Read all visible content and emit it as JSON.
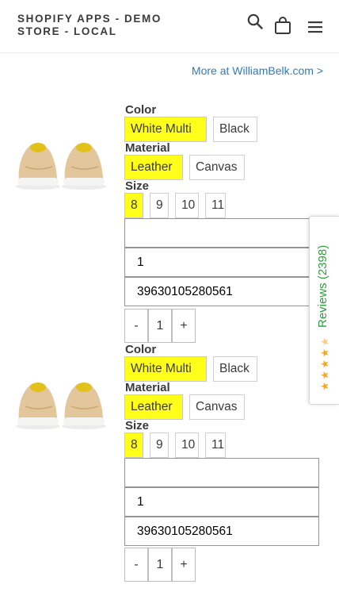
{
  "header": {
    "store_title": "SHOPIFY APPS - DEMO STORE - LOCAL",
    "icons": [
      "search-icon",
      "cart-icon",
      "menu-icon"
    ]
  },
  "more_link": "More at WilliamBelk.com >",
  "products": [
    {
      "image": "sneaker-image",
      "color_label": "Color",
      "colors": [
        "White Multi",
        "Black"
      ],
      "selected_color": "White Multi",
      "material_label": "Material",
      "materials": [
        "Leather",
        "Canvas"
      ],
      "selected_material": "Leather",
      "size_label": "Size",
      "sizes": [
        "8",
        "9",
        "10",
        "11"
      ],
      "selected_size": "8",
      "field_blank": "",
      "field_qty": "1",
      "field_variant_id": "39630105280561",
      "qty_minus": "-",
      "qty_value": "1",
      "qty_plus": "+"
    },
    {
      "image": "sneaker-image",
      "color_label": "Color",
      "colors": [
        "White Multi",
        "Black"
      ],
      "selected_color": "White Multi",
      "material_label": "Material",
      "materials": [
        "Leather",
        "Canvas"
      ],
      "selected_material": "Leather",
      "size_label": "Size",
      "sizes": [
        "8",
        "9",
        "10",
        "11"
      ],
      "selected_size": "8",
      "field_blank": "",
      "field_qty": "1",
      "field_variant_id": "39630105280561",
      "qty_minus": "-",
      "qty_value": "1",
      "qty_plus": "+"
    }
  ],
  "reviews_tab": {
    "label": "Reviews (2398)",
    "stars": 4.5,
    "colors": {
      "text": "#2f9c40",
      "star": "#f5a623"
    }
  },
  "colors": {
    "selected_chip": "#ffff1a",
    "link": "#337ab7",
    "text": "#3a3a3a"
  }
}
